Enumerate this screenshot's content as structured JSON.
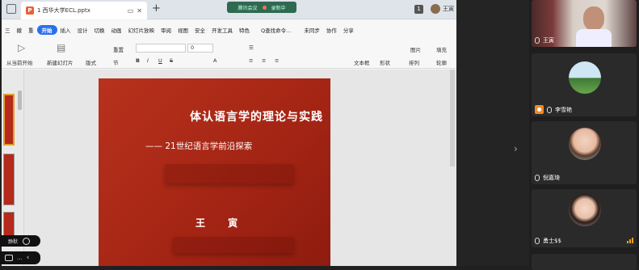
{
  "meeting": {
    "app_label": "腾讯会议",
    "status": "录制中"
  },
  "window": {
    "doc_tab": "1 西华大学ECL.pptx",
    "tab_badge": "1",
    "user_short": "王寅"
  },
  "menu": [
    "三",
    "撤",
    "重",
    "开始",
    "插入",
    "设计",
    "切换",
    "动画",
    "幻灯片放映",
    "审阅",
    "视图",
    "安全",
    "开发工具",
    "特色",
    "Q查找命令..."
  ],
  "menu_right": [
    "未同步",
    "协作",
    "分享"
  ],
  "ribbon": {
    "play_from_current": "从当前开始",
    "new_slide": "新建幻灯片",
    "layout": "版式",
    "section": "节",
    "reset": "重置",
    "font_size": "0",
    "textbox": "文本框",
    "shape": "形状",
    "arrange": "排列",
    "picture": "图片",
    "fill": "填充",
    "outline": "轮廓"
  },
  "slide": {
    "title": "体认语言学的理论与实践",
    "subtitle": "—— 21世纪语言学前沿探索",
    "author": "王 寅"
  },
  "chips": {
    "mic_label": "静默",
    "chat_label": "..."
  },
  "participants": [
    {
      "name": "王寅"
    },
    {
      "name": "李雪艳"
    },
    {
      "name": "倪嘉琦"
    },
    {
      "name": "勇士$$"
    }
  ],
  "colors": {
    "slide_red": "#ab2716",
    "accent_blue": "#2a6ff0",
    "meeting_green": "#2d6a4f"
  }
}
